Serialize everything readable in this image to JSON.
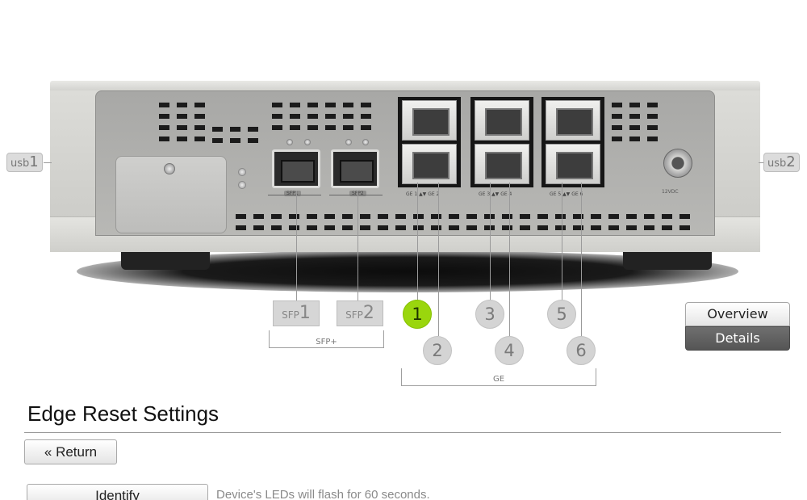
{
  "usb_ports": [
    {
      "prefix": "usb",
      "number": "1"
    },
    {
      "prefix": "usb",
      "number": "2"
    }
  ],
  "sfp_ports": [
    {
      "prefix": "SFP",
      "number": "1",
      "device_tag": "SFP1"
    },
    {
      "prefix": "SFP",
      "number": "2",
      "device_tag": "SFP2"
    }
  ],
  "sfp_group_label": "SFP+",
  "ge_ports": [
    "1",
    "2",
    "3",
    "4",
    "5",
    "6"
  ],
  "ge_group_label": "GE",
  "ge_device_tags": [
    "GE 1 ▲▼ GE 2",
    "GE 3 ▲▼ GE 4",
    "GE 5 ▲▼ GE 6"
  ],
  "power_tag": "12VDC",
  "active_port": "1",
  "colors": {
    "active_port": "#9ad60d",
    "details_bg": "#5e5e5e"
  },
  "view_toggle": {
    "overview": "Overview",
    "details": "Details",
    "selected": "Details"
  },
  "page": {
    "title": "Edge Reset Settings",
    "return_label": "Return",
    "return_icon": "«",
    "identify_label": "Identify",
    "identify_hint": "Device's LEDs will flash for 60 seconds."
  }
}
